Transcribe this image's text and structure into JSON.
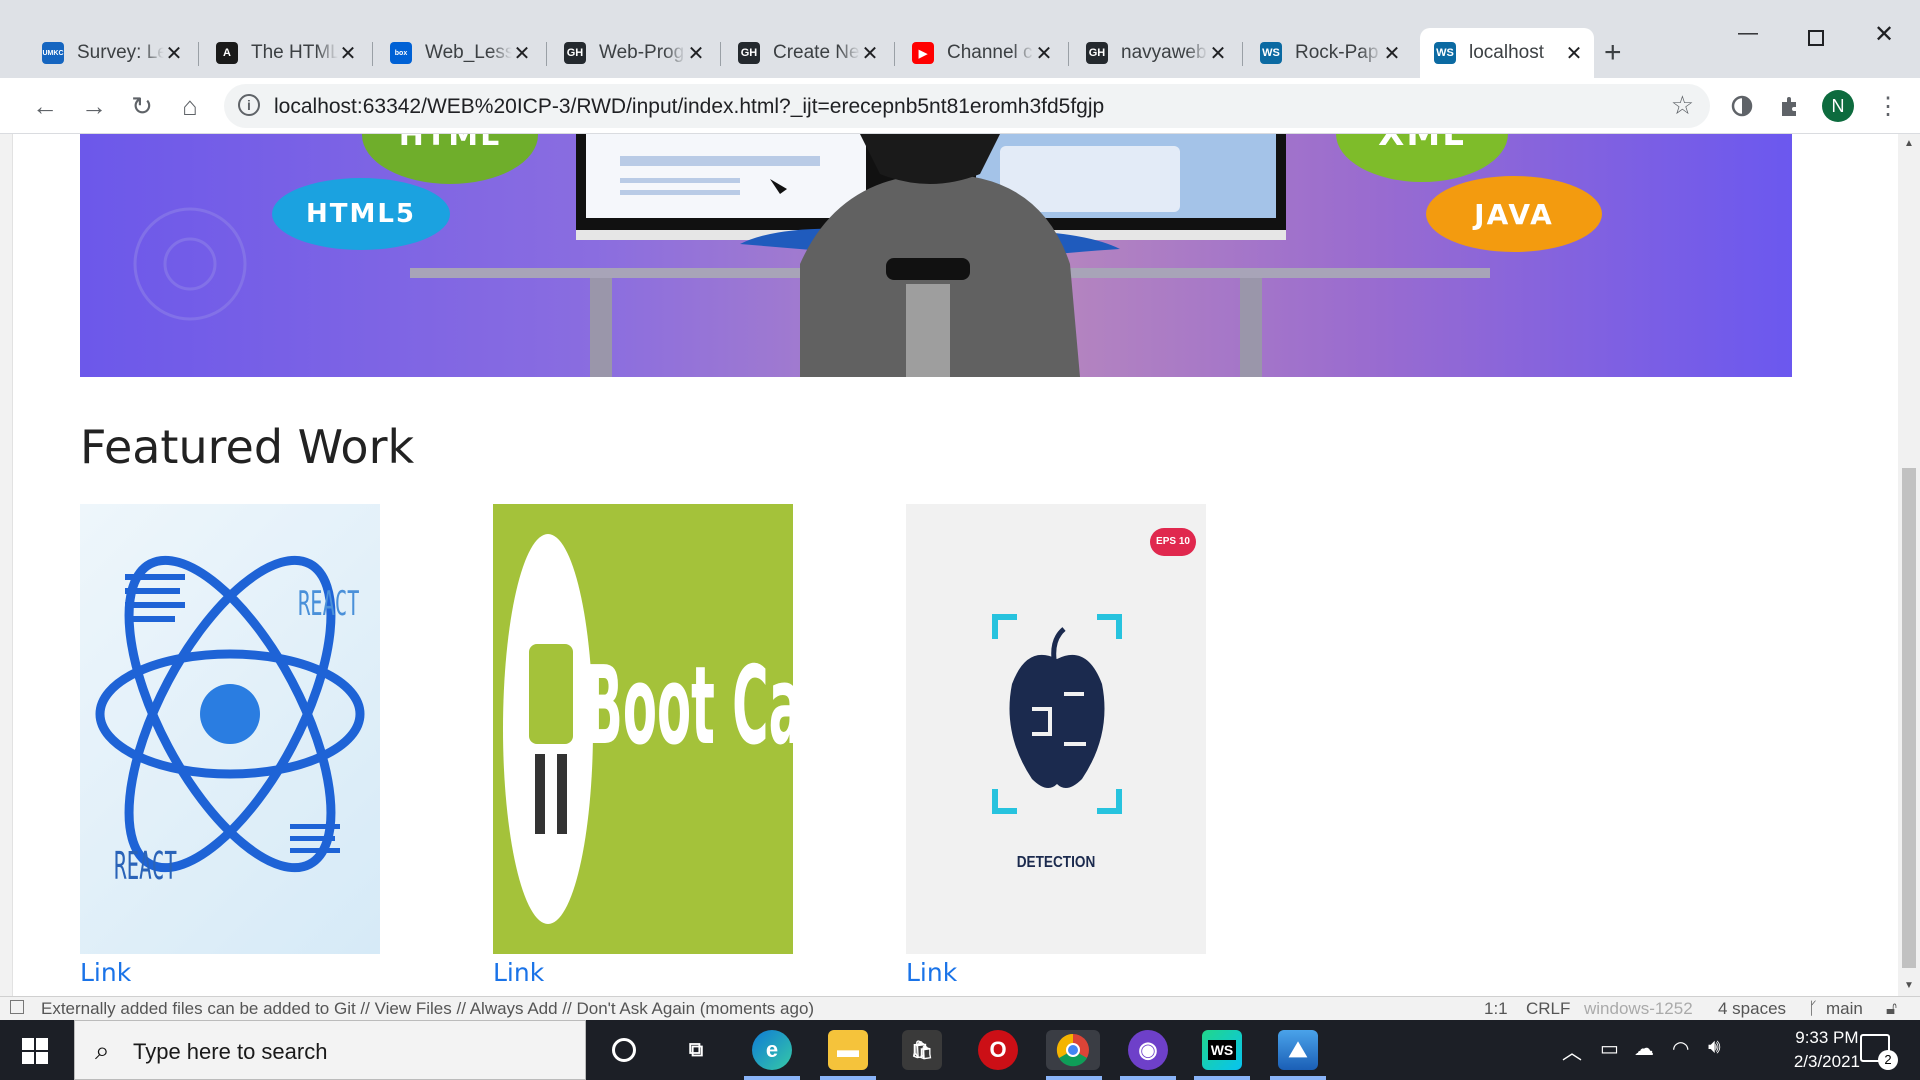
{
  "browser": {
    "tabs": [
      {
        "title": "Survey: Le",
        "favicon_text": "UMKC",
        "favicon_color": "#1565c0"
      },
      {
        "title": "The HTML",
        "favicon_text": "A",
        "favicon_color": "#1a1a1a"
      },
      {
        "title": "Web_Less",
        "favicon_text": "box",
        "favicon_color": "#0061d5"
      },
      {
        "title": "Web-Prog",
        "favicon_text": "GH",
        "favicon_color": "#24292e"
      },
      {
        "title": "Create Ne",
        "favicon_text": "GH",
        "favicon_color": "#24292e"
      },
      {
        "title": "Channel c",
        "favicon_text": "▶",
        "favicon_color": "#ff0000"
      },
      {
        "title": "navyaweb",
        "favicon_text": "GH",
        "favicon_color": "#24292e"
      },
      {
        "title": "Rock-Pap",
        "favicon_text": "WS",
        "favicon_color": "#0b6aa2"
      },
      {
        "title": "localhost",
        "favicon_text": "WS",
        "favicon_color": "#0b6aa2",
        "active": true
      }
    ],
    "new_tab_label": "+",
    "url": "localhost:63342/WEB%20ICP-3/RWD/input/index.html?_ijt=erecepnb5nt81eromh3fd5fgjp",
    "profile_initial": "N"
  },
  "page": {
    "hero_badges": [
      "HTML",
      "HTML5",
      "XML",
      "JAVA"
    ],
    "featured_title": "Featured Work",
    "cards": [
      {
        "image_text": "REACT",
        "image_text_2": "REACT",
        "link_label": "Link"
      },
      {
        "image_text": "Boot Camp",
        "link_label": "Link"
      },
      {
        "image_text": "DETECTION",
        "badge": "EPS 10",
        "link_label": "Link"
      }
    ]
  },
  "ide_status": {
    "message": "Externally added files can be added to Git // View Files // Always Add // Don't Ask Again (moments ago)",
    "position": "1:1",
    "line_sep": "CRLF",
    "encoding": "windows-1252",
    "indent": "4 spaces",
    "branch": "main"
  },
  "taskbar": {
    "search_placeholder": "Type here to search",
    "time": "9:33 PM",
    "date": "2/3/2021",
    "notification_count": "2"
  },
  "colors": {
    "accent_blue": "#1a73e8",
    "bootcamp_green": "#a4c23a",
    "detection_navy": "#1b2a4e",
    "detection_cyan": "#27c3de"
  }
}
